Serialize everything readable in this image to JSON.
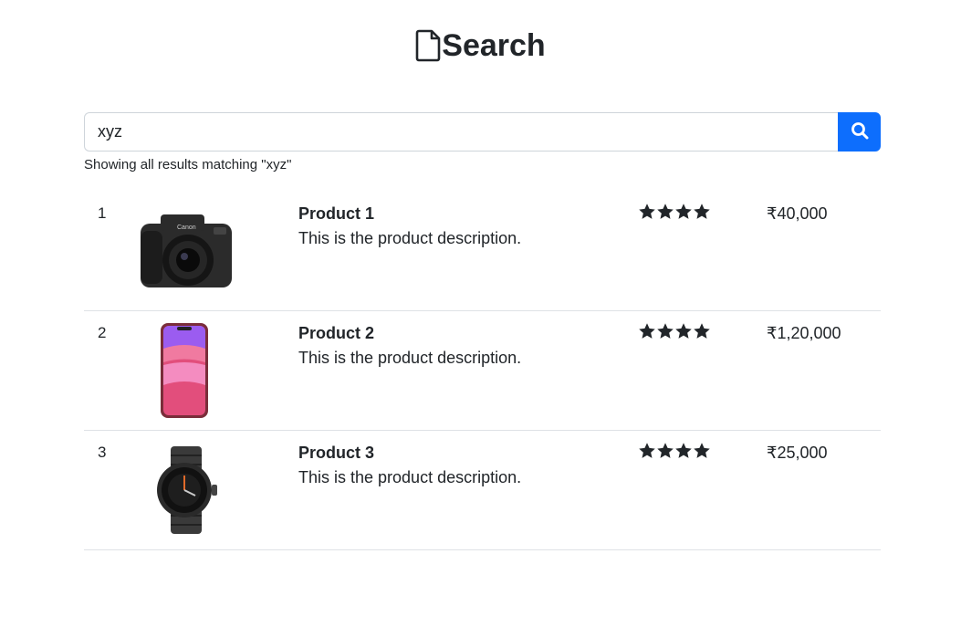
{
  "header": {
    "title": "Search",
    "icon": "file-icon"
  },
  "search": {
    "value": "xyz",
    "placeholder": "",
    "button_icon": "search-icon",
    "button_color": "#0d6efd"
  },
  "results_summary": "Showing all results matching \"xyz\"",
  "products": [
    {
      "index": "1",
      "image": "camera-image",
      "name": "Product 1",
      "description": "This is the product description.",
      "rating": 4,
      "price": "₹40,000"
    },
    {
      "index": "2",
      "image": "phone-image",
      "name": "Product 2",
      "description": "This is the product description.",
      "rating": 4,
      "price": "₹1,20,000"
    },
    {
      "index": "3",
      "image": "watch-image",
      "name": "Product 3",
      "description": "This is the product description.",
      "rating": 4,
      "price": "₹25,000"
    }
  ]
}
